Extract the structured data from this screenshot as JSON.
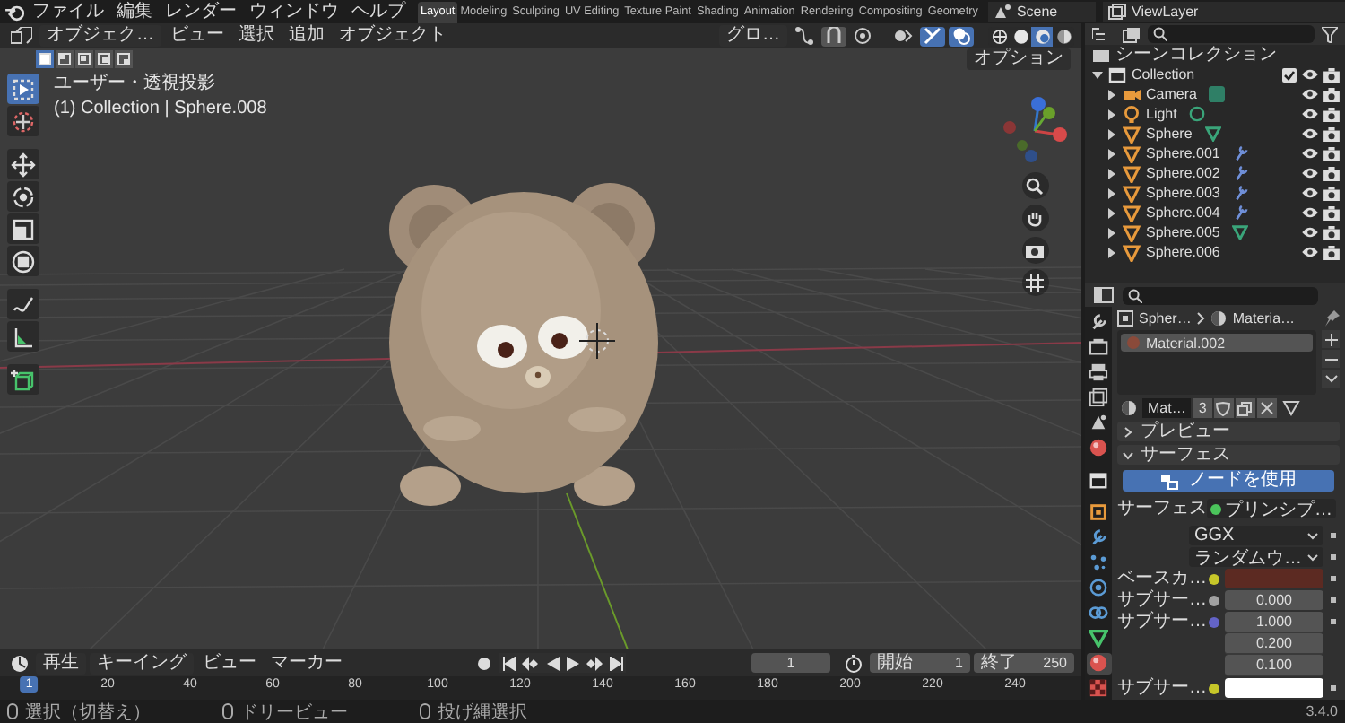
{
  "top_bar": {
    "menus": [
      "ファイル",
      "編集",
      "レンダー",
      "ウィンドウ",
      "ヘルプ"
    ],
    "workspaces": [
      {
        "label": "Layout",
        "selected": true
      },
      {
        "label": "Modeling",
        "selected": false
      },
      {
        "label": "Sculpting",
        "selected": false
      },
      {
        "label": "UV Editing",
        "selected": false
      },
      {
        "label": "Texture Paint",
        "selected": false
      },
      {
        "label": "Shading",
        "selected": false
      },
      {
        "label": "Animation",
        "selected": false
      },
      {
        "label": "Rendering",
        "selected": false
      },
      {
        "label": "Compositing",
        "selected": false
      },
      {
        "label": "Geometry",
        "selected": false
      }
    ],
    "scene": "Scene",
    "view_layer": "ViewLayer"
  },
  "viewport": {
    "mode": "オブジェク…",
    "menus": [
      "ビュー",
      "選択",
      "追加",
      "オブジェクト"
    ],
    "orientation": "グロ…",
    "shading_modes": [
      {
        "selected": false
      },
      {
        "selected": false
      },
      {
        "selected": true
      },
      {
        "selected": false
      }
    ],
    "selection_modes": [
      {
        "selected": true
      },
      {
        "selected": false
      },
      {
        "selected": false
      },
      {
        "selected": false
      },
      {
        "selected": false
      }
    ],
    "options": "オプション",
    "tools": [
      {
        "kind": "select",
        "selected": true
      },
      {
        "kind": "cursor",
        "selected": false
      },
      {
        "kind": "move",
        "selected": false
      },
      {
        "kind": "rotate",
        "selected": false
      },
      {
        "kind": "scale",
        "selected": false
      },
      {
        "kind": "transform",
        "selected": false
      },
      {
        "kind": "annotate",
        "selected": false
      },
      {
        "kind": "measure",
        "selected": false
      },
      {
        "kind": "add_cube",
        "selected": false
      }
    ],
    "view_name": "ユーザー・透視投影",
    "object_info": "(1) Collection | Sphere.008"
  },
  "timeline": {
    "menus": [
      "再生",
      "キーイング",
      "ビュー",
      "マーカー"
    ],
    "current_frame": "1",
    "start_label": "開始",
    "start": "1",
    "end_label": "終了",
    "end": "250",
    "playhead": "1",
    "ruler": [
      "20",
      "40",
      "60",
      "80",
      "100",
      "120",
      "140",
      "160",
      "180",
      "200",
      "220",
      "240"
    ]
  },
  "status_bar": {
    "hints": [
      "選択（切替え）",
      "ドリービュー",
      "投げ縄選択"
    ],
    "version": "3.4.0"
  },
  "outliner": {
    "root": "シーンコレクション",
    "items": [
      {
        "label": "Collection",
        "kind": "collection",
        "expanded": true,
        "checked": true,
        "children": [
          {
            "label": "Camera",
            "kind": "camera",
            "data_icon": {
              "kind": "camera"
            },
            "expanded": false
          },
          {
            "label": "Light",
            "kind": "light",
            "data_icon": {
              "kind": "light"
            },
            "expanded": false
          },
          {
            "label": "Sphere",
            "kind": "mesh",
            "data_icon": {
              "kind": "mesh"
            },
            "expanded": false
          },
          {
            "label": "Sphere.001",
            "kind": "mesh",
            "data_icon": {
              "kind": "modifier"
            },
            "expanded": false
          },
          {
            "label": "Sphere.002",
            "kind": "mesh",
            "data_icon": {
              "kind": "modifier"
            },
            "expanded": false
          },
          {
            "label": "Sphere.003",
            "kind": "mesh",
            "data_icon": {
              "kind": "modifier"
            },
            "expanded": false
          },
          {
            "label": "Sphere.004",
            "kind": "mesh",
            "data_icon": {
              "kind": "modifier"
            },
            "expanded": false
          },
          {
            "label": "Sphere.005",
            "kind": "mesh",
            "data_icon": {
              "kind": "mesh"
            },
            "expanded": false
          },
          {
            "label": "Sphere.006",
            "kind": "mesh",
            "expanded": false
          }
        ]
      }
    ]
  },
  "properties": {
    "tabs": [
      {
        "kind": "tool",
        "selected": false
      },
      {
        "kind": "render",
        "selected": false
      },
      {
        "kind": "output",
        "selected": false
      },
      {
        "kind": "view_layer",
        "selected": false
      },
      {
        "kind": "scene",
        "selected": false
      },
      {
        "kind": "world",
        "selected": false
      },
      {
        "kind": "collection",
        "selected": false
      },
      {
        "kind": "object",
        "selected": false
      },
      {
        "kind": "modifier",
        "selected": false
      },
      {
        "kind": "particles",
        "selected": false
      },
      {
        "kind": "physics",
        "selected": false
      },
      {
        "kind": "constraints",
        "selected": false
      },
      {
        "kind": "data",
        "selected": false
      },
      {
        "kind": "material",
        "selected": true
      },
      {
        "kind": "texture",
        "selected": false
      }
    ],
    "breadcrumb": [
      "Spher…",
      "Materia…"
    ],
    "slots": [
      {
        "label": "Material.002",
        "selected": true
      }
    ],
    "material": {
      "name": "Mat…",
      "users": "3"
    },
    "panels": [
      {
        "label": "プレビュー",
        "expanded": false
      },
      {
        "label": "サーフェス",
        "expanded": true
      }
    ],
    "use_nodes": "ノードを使用",
    "rows": [
      {
        "kind": "shader",
        "label": "サーフェス",
        "color": "#4bc45b",
        "value": "プリンシプ…"
      },
      {
        "kind": "dropdown",
        "value": "GGX"
      },
      {
        "kind": "dropdown",
        "value": "ランダムウ…"
      },
      {
        "kind": "color",
        "label": "ベースカ…",
        "color": "#c7c729",
        "swatch": {
          "color": "#5c2a22"
        }
      },
      {
        "kind": "number",
        "label": "サブサー…",
        "color": "#a1a1a1",
        "value": "0.000"
      },
      {
        "kind": "vector",
        "label": "サブサー…",
        "color": "#6363c7",
        "values": [
          "1.000",
          "0.200",
          "0.100"
        ]
      },
      {
        "kind": "color",
        "label": "サブサー…",
        "color": "#c7c729",
        "swatch": {
          "color": "#ffffff"
        }
      }
    ]
  }
}
